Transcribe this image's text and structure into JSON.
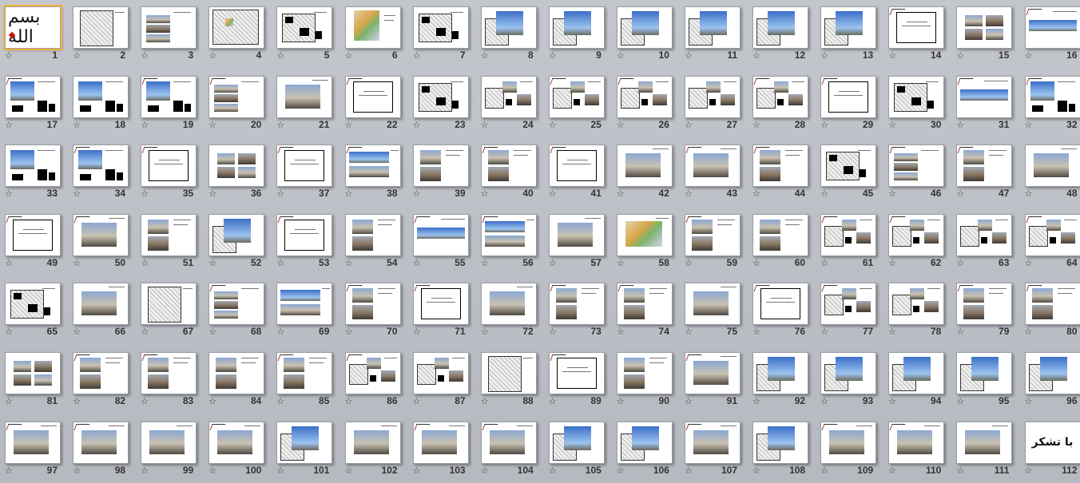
{
  "view": "slide-sorter",
  "slide_count": 112,
  "star_glyph": "☆",
  "first_slide_calligraphy": "بسم الله",
  "closing_slide_text": "با تشکر",
  "slides": [
    {
      "num": "1",
      "kind": "calligraphy"
    },
    {
      "num": "2",
      "kind": "map"
    },
    {
      "num": "3",
      "kind": "photos3"
    },
    {
      "num": "4",
      "kind": "colormap"
    },
    {
      "num": "5",
      "kind": "blackmap"
    },
    {
      "num": "6",
      "kind": "colormap2"
    },
    {
      "num": "7",
      "kind": "blackmap"
    },
    {
      "num": "8",
      "kind": "photo-overlay"
    },
    {
      "num": "9",
      "kind": "photo-overlay"
    },
    {
      "num": "10",
      "kind": "photo-overlay"
    },
    {
      "num": "11",
      "kind": "photo-overlay"
    },
    {
      "num": "12",
      "kind": "photo-overlay"
    },
    {
      "num": "13",
      "kind": "photo-overlay"
    },
    {
      "num": "14",
      "kind": "title"
    },
    {
      "num": "15",
      "kind": "photos4"
    },
    {
      "num": "16",
      "kind": "panorama"
    },
    {
      "num": "17",
      "kind": "skyline"
    },
    {
      "num": "18",
      "kind": "skyline"
    },
    {
      "num": "19",
      "kind": "skyline"
    },
    {
      "num": "20",
      "kind": "photos3"
    },
    {
      "num": "21",
      "kind": "photo"
    },
    {
      "num": "22",
      "kind": "title"
    },
    {
      "num": "23",
      "kind": "blackmap"
    },
    {
      "num": "24",
      "kind": "collage"
    },
    {
      "num": "25",
      "kind": "collage"
    },
    {
      "num": "26",
      "kind": "collage"
    },
    {
      "num": "27",
      "kind": "collage"
    },
    {
      "num": "28",
      "kind": "collage"
    },
    {
      "num": "29",
      "kind": "title"
    },
    {
      "num": "30",
      "kind": "blackmap"
    },
    {
      "num": "31",
      "kind": "panorama"
    },
    {
      "num": "32",
      "kind": "skyline"
    },
    {
      "num": "33",
      "kind": "skyline"
    },
    {
      "num": "34",
      "kind": "skyline"
    },
    {
      "num": "35",
      "kind": "title"
    },
    {
      "num": "36",
      "kind": "photos4"
    },
    {
      "num": "37",
      "kind": "title"
    },
    {
      "num": "38",
      "kind": "panorama2"
    },
    {
      "num": "39",
      "kind": "photos2"
    },
    {
      "num": "40",
      "kind": "photos2"
    },
    {
      "num": "41",
      "kind": "title"
    },
    {
      "num": "42",
      "kind": "photo"
    },
    {
      "num": "43",
      "kind": "photo"
    },
    {
      "num": "44",
      "kind": "photos2"
    },
    {
      "num": "45",
      "kind": "blackmap"
    },
    {
      "num": "46",
      "kind": "photos3"
    },
    {
      "num": "47",
      "kind": "photos2"
    },
    {
      "num": "48",
      "kind": "photo"
    },
    {
      "num": "49",
      "kind": "title"
    },
    {
      "num": "50",
      "kind": "photo"
    },
    {
      "num": "51",
      "kind": "photos2"
    },
    {
      "num": "52",
      "kind": "photo-overlay"
    },
    {
      "num": "53",
      "kind": "title"
    },
    {
      "num": "54",
      "kind": "photos2"
    },
    {
      "num": "55",
      "kind": "panorama"
    },
    {
      "num": "56",
      "kind": "panorama2"
    },
    {
      "num": "57",
      "kind": "photo"
    },
    {
      "num": "58",
      "kind": "colorful"
    },
    {
      "num": "59",
      "kind": "photos2"
    },
    {
      "num": "60",
      "kind": "photos2"
    },
    {
      "num": "61",
      "kind": "collage"
    },
    {
      "num": "62",
      "kind": "collage"
    },
    {
      "num": "63",
      "kind": "collage"
    },
    {
      "num": "64",
      "kind": "collage"
    },
    {
      "num": "65",
      "kind": "blackmap"
    },
    {
      "num": "66",
      "kind": "photo"
    },
    {
      "num": "67",
      "kind": "map"
    },
    {
      "num": "68",
      "kind": "photos3"
    },
    {
      "num": "69",
      "kind": "panorama2"
    },
    {
      "num": "70",
      "kind": "photos2"
    },
    {
      "num": "71",
      "kind": "title"
    },
    {
      "num": "72",
      "kind": "photo"
    },
    {
      "num": "73",
      "kind": "photos2"
    },
    {
      "num": "74",
      "kind": "photos2"
    },
    {
      "num": "75",
      "kind": "photo"
    },
    {
      "num": "76",
      "kind": "title"
    },
    {
      "num": "77",
      "kind": "collage"
    },
    {
      "num": "78",
      "kind": "collage"
    },
    {
      "num": "79",
      "kind": "photos2"
    },
    {
      "num": "80",
      "kind": "photos2"
    },
    {
      "num": "81",
      "kind": "photos4"
    },
    {
      "num": "82",
      "kind": "photos2"
    },
    {
      "num": "83",
      "kind": "photos2"
    },
    {
      "num": "84",
      "kind": "photos2"
    },
    {
      "num": "85",
      "kind": "photos2"
    },
    {
      "num": "86",
      "kind": "collage"
    },
    {
      "num": "87",
      "kind": "collage"
    },
    {
      "num": "88",
      "kind": "map"
    },
    {
      "num": "89",
      "kind": "title"
    },
    {
      "num": "90",
      "kind": "photos2"
    },
    {
      "num": "91",
      "kind": "photo"
    },
    {
      "num": "92",
      "kind": "photo-overlay"
    },
    {
      "num": "93",
      "kind": "photo-overlay"
    },
    {
      "num": "94",
      "kind": "photo-overlay"
    },
    {
      "num": "95",
      "kind": "photo-overlay"
    },
    {
      "num": "96",
      "kind": "photo-overlay"
    },
    {
      "num": "97",
      "kind": "photo"
    },
    {
      "num": "98",
      "kind": "photo"
    },
    {
      "num": "99",
      "kind": "photo"
    },
    {
      "num": "100",
      "kind": "photo"
    },
    {
      "num": "101",
      "kind": "photo-overlay"
    },
    {
      "num": "102",
      "kind": "photo"
    },
    {
      "num": "103",
      "kind": "photo"
    },
    {
      "num": "104",
      "kind": "photo"
    },
    {
      "num": "105",
      "kind": "photo-overlay"
    },
    {
      "num": "106",
      "kind": "photo-overlay"
    },
    {
      "num": "107",
      "kind": "photo"
    },
    {
      "num": "108",
      "kind": "photo-overlay"
    },
    {
      "num": "109",
      "kind": "photo"
    },
    {
      "num": "110",
      "kind": "photo"
    },
    {
      "num": "111",
      "kind": "photo"
    },
    {
      "num": "112",
      "kind": "closing"
    }
  ]
}
